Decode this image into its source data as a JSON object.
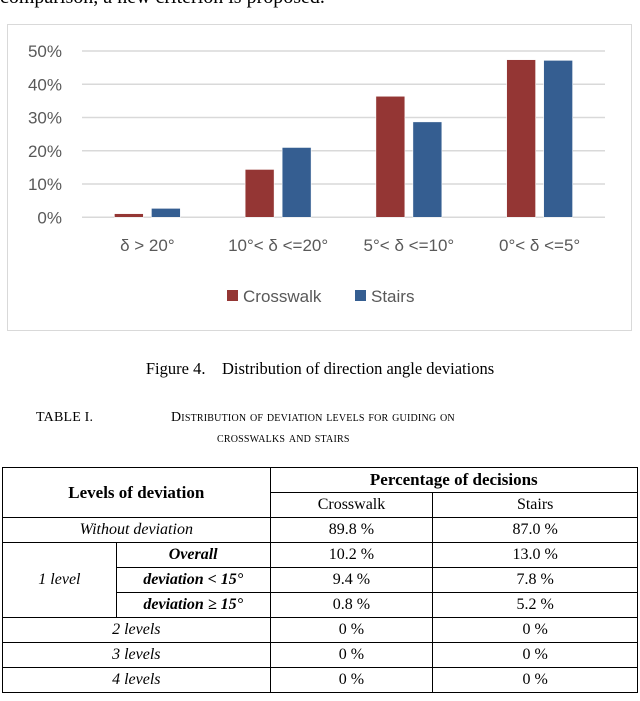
{
  "document": {
    "intro_text": "comparison, a new criterion is proposed.",
    "figure_caption": "Figure 4.    Distribution of direction angle deviations",
    "table_label": "TABLE I.",
    "table_title_line1": "Distribution of deviation levels for guiding on",
    "table_title_line2": "crosswalks and stairs"
  },
  "chart_data": {
    "type": "bar",
    "title": "",
    "xlabel": "",
    "ylabel": "",
    "categories": [
      "δ > 20°",
      "10°< δ <=20°",
      "5°< δ <=10°",
      "0°< δ <=5°"
    ],
    "series": [
      {
        "name": "Crosswalk",
        "color": "#943634",
        "values": [
          1.1,
          14.4,
          36.4,
          47.4
        ]
      },
      {
        "name": "Stairs",
        "color": "#355E91",
        "values": [
          2.7,
          21.0,
          28.7,
          47.2
        ]
      }
    ],
    "ylim": [
      0,
      50
    ],
    "yticks": [
      "0%",
      "10%",
      "20%",
      "30%",
      "40%",
      "50%"
    ],
    "ytick_values": [
      0,
      10,
      20,
      30,
      40,
      50
    ],
    "grid": true,
    "legend_position": "bottom-center"
  },
  "table": {
    "header": {
      "levels": "Levels of deviation",
      "percentage": "Percentage of decisions",
      "crosswalk": "Crosswalk",
      "stairs": "Stairs"
    },
    "rows": {
      "without": {
        "label": "Without deviation",
        "crosswalk": "89.8 %",
        "stairs": "87.0 %"
      },
      "one_level": {
        "label": "1 level",
        "overall": {
          "label": "Overall",
          "crosswalk": "10.2 %",
          "stairs": "13.0 %"
        },
        "lt15": {
          "label": "deviation < 15°",
          "crosswalk": "9.4 %",
          "stairs": "7.8 %"
        },
        "ge15": {
          "label": "deviation ≥ 15°",
          "crosswalk": "0.8 %",
          "stairs": "5.2 %"
        }
      },
      "two": {
        "label": "2 levels",
        "crosswalk": "0 %",
        "stairs": "0 %"
      },
      "three": {
        "label": "3 levels",
        "crosswalk": "0 %",
        "stairs": "0 %"
      },
      "four": {
        "label": "4 levels",
        "crosswalk": "0 %",
        "stairs": "0 %"
      }
    }
  }
}
